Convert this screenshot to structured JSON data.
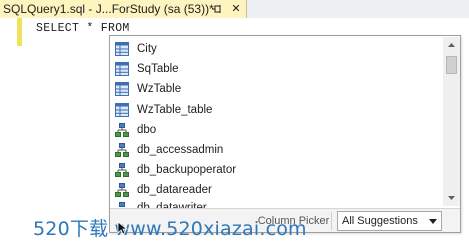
{
  "tab": {
    "title": "SQLQuery1.sql - J...ForStudy (sa (53))*",
    "close_glyph": "✕"
  },
  "editor": {
    "code_line": "SELECT * FROM",
    "margin_color": "#f2e15c"
  },
  "suggestions": {
    "items": [
      {
        "label": "City",
        "icon": "table-icon"
      },
      {
        "label": "SqTable",
        "icon": "table-icon"
      },
      {
        "label": "WzTable",
        "icon": "table-icon"
      },
      {
        "label": "WzTable_table",
        "icon": "table-icon"
      },
      {
        "label": "dbo",
        "icon": "schema-icon"
      },
      {
        "label": "db_accessadmin",
        "icon": "schema-icon"
      },
      {
        "label": "db_backupoperator",
        "icon": "schema-icon"
      },
      {
        "label": "db_datareader",
        "icon": "schema-icon"
      },
      {
        "label": "db_datawriter",
        "icon": "schema-icon"
      }
    ],
    "column_picker": "Column Picker",
    "filter_dropdown": "All Suggestions"
  },
  "watermark": {
    "text": "520下载 www.520xiazai.com",
    "color": "#2f77b8"
  }
}
